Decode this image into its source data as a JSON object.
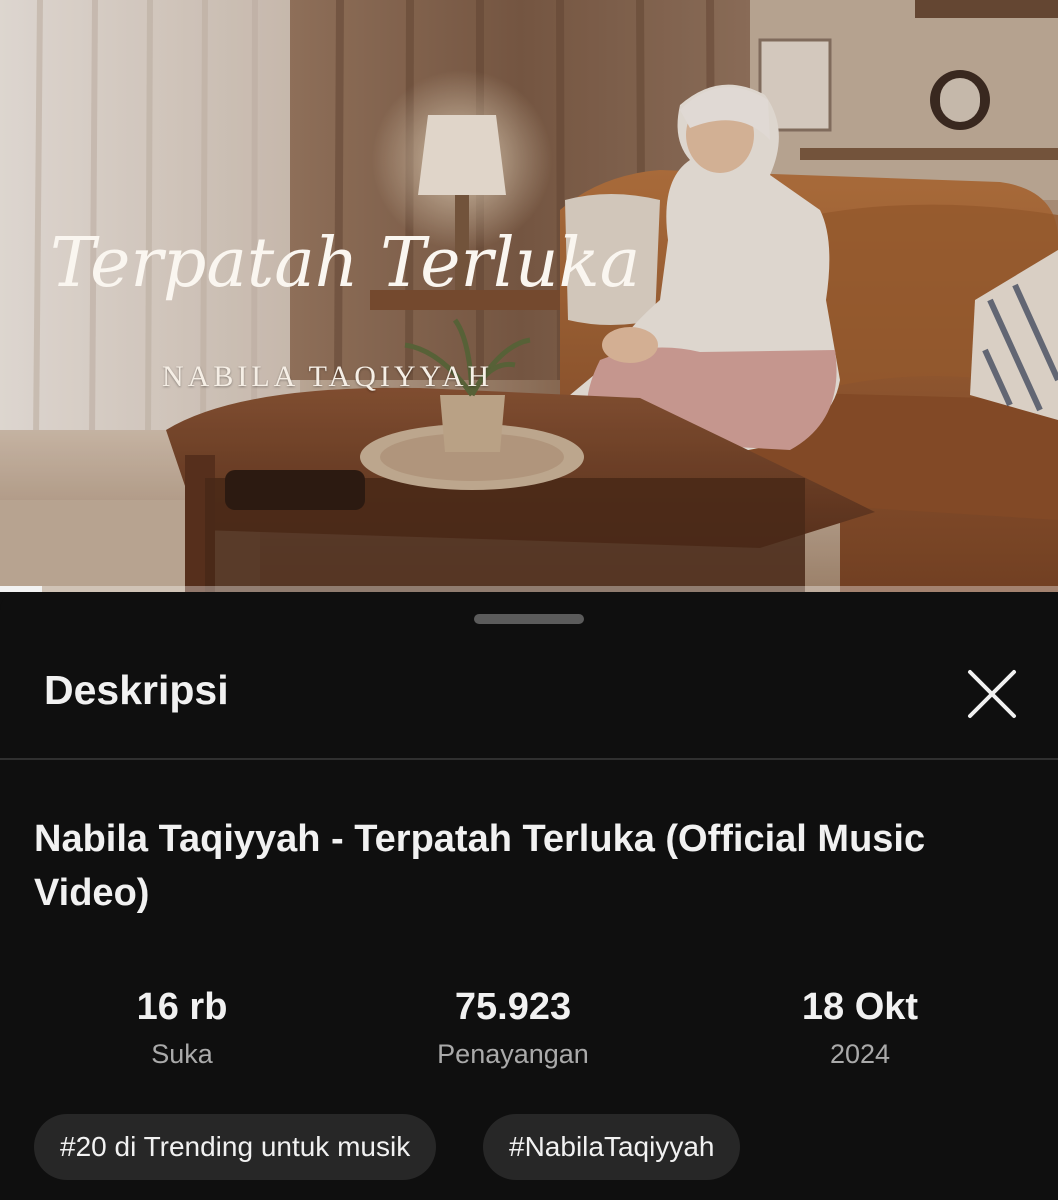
{
  "video": {
    "overlay_title": "Terpatah Terluka",
    "overlay_artist": "NABILA TAQIYYAH",
    "progress_percent": 4
  },
  "sheet": {
    "title": "Deskripsi",
    "close_icon": "close-icon"
  },
  "details": {
    "video_title": "Nabila Taqiyyah - Terpatah Terluka (Official Music Video)",
    "stats": [
      {
        "value": "16 rb",
        "label": "Suka"
      },
      {
        "value": "75.923",
        "label": "Penayangan"
      },
      {
        "value": "18 Okt",
        "label": "2024"
      }
    ],
    "chips": [
      {
        "label": "#20 di Trending untuk musik"
      },
      {
        "label": "#NabilaTaqiyyah"
      }
    ]
  },
  "colors": {
    "background": "#0f0f0f",
    "chip_background": "#272727",
    "text_primary": "#f1f1f1",
    "text_secondary": "#aaaaaa"
  }
}
